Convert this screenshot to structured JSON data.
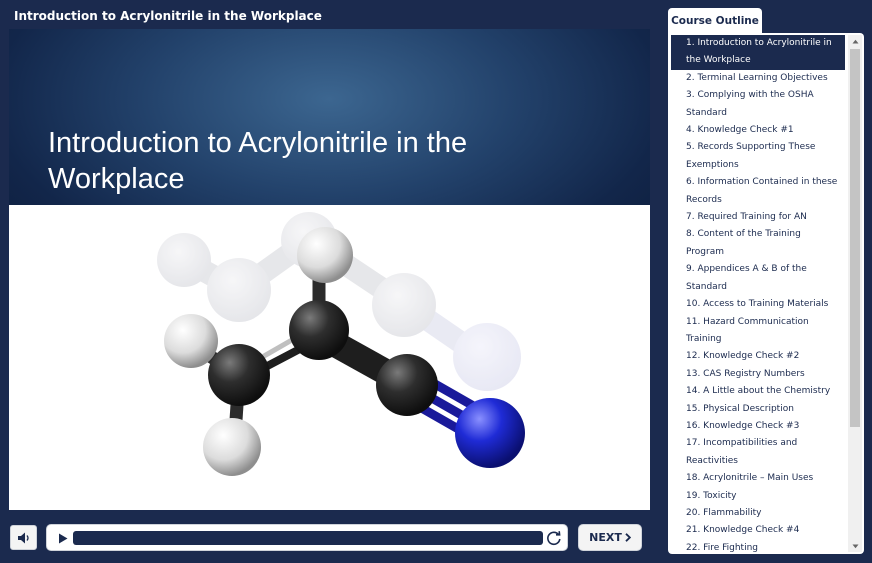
{
  "header": {
    "course_title": "Introduction to Acrylonitrile in the Workplace"
  },
  "slide": {
    "heading": "Introduction to Acrylonitrile in the Workplace"
  },
  "player": {
    "next_label": "NEXT"
  },
  "outline": {
    "tab_label": "Course Outline",
    "items": [
      "1. Introduction to Acrylonitrile in the Workplace",
      "2. Terminal Learning Objectives",
      "3. Complying with the OSHA Standard",
      "4. Knowledge Check #1",
      "5. Records Supporting These Exemptions",
      "6. Information Contained in these Records",
      "7. Required Training for AN",
      "8. Content of the Training Program",
      "9. Appendices A & B of the Standard",
      "10. Access to Training Materials",
      "11. Hazard Communication Training",
      "12. Knowledge Check #2",
      "13. CAS Registry Numbers",
      "14. A Little about the Chemistry",
      "15. Physical Description",
      "16. Knowledge Check #3",
      "17. Incompatibilities and Reactivities",
      "18. Acrylonitrile – Main Uses",
      "19. Toxicity",
      "20. Flammability",
      "21. Knowledge Check #4",
      "22. Fire Fighting"
    ]
  },
  "colors": {
    "navy": "#1b2a4e",
    "banner_light": "#3c6690",
    "nitrogen_blue": "#1f2bd6",
    "carbon": "#2a2a2a",
    "hydrogen": "#ececec"
  }
}
